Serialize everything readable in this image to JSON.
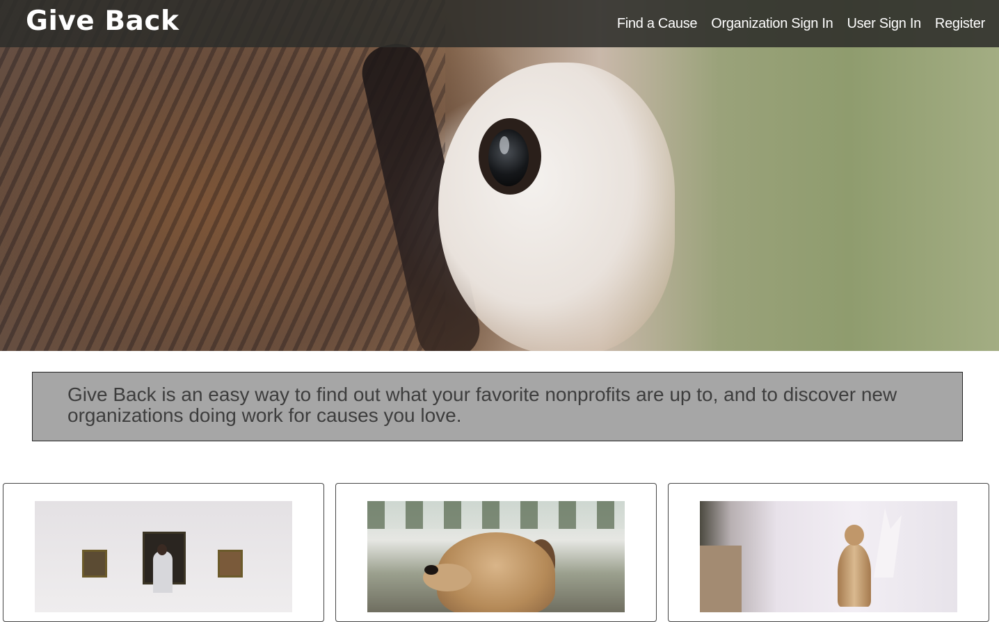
{
  "header": {
    "brand": "Give Back",
    "nav": {
      "find_cause": "Find a Cause",
      "org_sign_in": "Organization Sign In",
      "user_sign_in": "User Sign In",
      "register": "Register"
    }
  },
  "hero": {
    "image": "owl-closeup-photo"
  },
  "intro": {
    "text": "Give Back is an easy way to find out what your favorite nonprofits are up to, and to discover new organizations doing work for causes you love."
  },
  "cards": [
    {
      "image": "art-gallery-photo"
    },
    {
      "image": "dog-photo"
    },
    {
      "image": "sculpture-studio-photo"
    }
  ],
  "colors": {
    "navbar": "#2d2d2a",
    "intro_bg": "#a6a6a6",
    "intro_text": "#3d3d3d"
  }
}
